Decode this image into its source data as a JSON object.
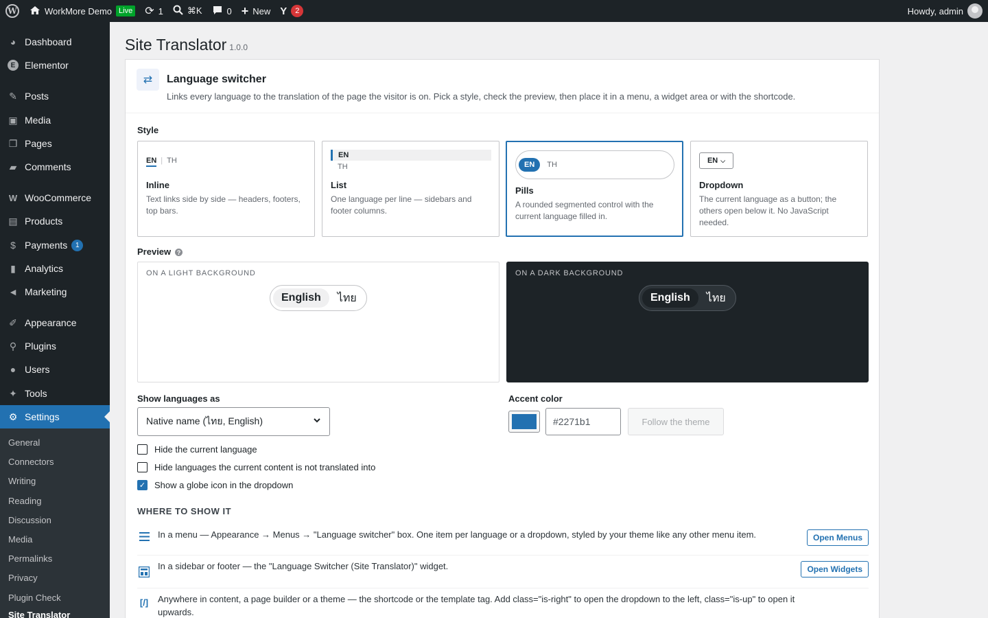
{
  "adminbar": {
    "site_name": "WorkMore Demo",
    "live_badge": "Live",
    "updates_count": "1",
    "search_shortcut": "⌘K",
    "comments_count": "0",
    "new_label": "New",
    "yoast_count": "2",
    "howdy": "Howdy, admin"
  },
  "sidebar": {
    "items": [
      {
        "label": "Dashboard",
        "icon": "dashboard-icon"
      },
      {
        "label": "Elementor",
        "icon": "elementor-icon"
      },
      {
        "label": "Posts",
        "icon": "pin-icon"
      },
      {
        "label": "Media",
        "icon": "media-icon"
      },
      {
        "label": "Pages",
        "icon": "pages-icon"
      },
      {
        "label": "Comments",
        "icon": "comment-icon"
      },
      {
        "label": "WooCommerce",
        "icon": "woo-icon"
      },
      {
        "label": "Products",
        "icon": "archive-icon"
      },
      {
        "label": "Payments",
        "icon": "payments-icon",
        "badge": "1"
      },
      {
        "label": "Analytics",
        "icon": "bar-chart-icon"
      },
      {
        "label": "Marketing",
        "icon": "megaphone-icon"
      },
      {
        "label": "Appearance",
        "icon": "brush-icon"
      },
      {
        "label": "Plugins",
        "icon": "plugin-icon"
      },
      {
        "label": "Users",
        "icon": "user-icon"
      },
      {
        "label": "Tools",
        "icon": "wrench-icon"
      },
      {
        "label": "Settings",
        "icon": "settings-icon"
      }
    ],
    "submenu": [
      "General",
      "Connectors",
      "Writing",
      "Reading",
      "Discussion",
      "Media",
      "Permalinks",
      "Privacy",
      "Plugin Check",
      "Site Translator"
    ]
  },
  "page": {
    "title": "Site Translator",
    "version": "1.0.0"
  },
  "card": {
    "title": "Language switcher",
    "description": "Links every language to the translation of the page the visitor is on. Pick a style, check the preview, then place it in a menu, a widget area or with the shortcode."
  },
  "style": {
    "label": "Style",
    "options": [
      {
        "name": "Inline",
        "desc": "Text links side by side — headers, footers, top bars.",
        "sample_on": "EN",
        "sample_off": "TH"
      },
      {
        "name": "List",
        "desc": "One language per line — sidebars and footer columns.",
        "sample_on": "EN",
        "sample_off": "TH"
      },
      {
        "name": "Pills",
        "desc": "A rounded segmented control with the current language filled in.",
        "sample_on": "EN",
        "sample_off": "TH"
      },
      {
        "name": "Dropdown",
        "desc": "The current language as a button; the others open below it. No JavaScript needed.",
        "sample_on": "EN"
      }
    ],
    "selected": "Pills"
  },
  "preview": {
    "label": "Preview",
    "help": "?",
    "light_caption": "ON A LIGHT BACKGROUND",
    "dark_caption": "ON A DARK BACKGROUND",
    "lang_current": "English",
    "lang_other": "ไทย"
  },
  "show_as": {
    "label": "Show languages as",
    "value": "Native name (ไทย, English)"
  },
  "accent": {
    "label": "Accent color",
    "color": "#2271b1",
    "hex_value": "#2271b1",
    "theme_button": "Follow the theme"
  },
  "options": [
    {
      "label": "Hide the current language",
      "checked": false
    },
    {
      "label": "Hide languages the current content is not translated into",
      "checked": false
    },
    {
      "label": "Show a globe icon in the dropdown",
      "checked": true
    }
  ],
  "where": {
    "heading": "WHERE TO SHOW IT",
    "rows": [
      {
        "icon": "menu-icon",
        "text": "In a menu — Appearance → Menus → \"Language switcher\" box. One item per language or a dropdown, styled by your theme like any other menu item.",
        "button": "Open Menus"
      },
      {
        "icon": "widget-icon",
        "text": "In a sidebar or footer — the \"Language Switcher (Site Translator)\" widget.",
        "button": "Open Widgets"
      },
      {
        "icon": "shortcode-icon",
        "text_line1": "Anywhere in content, a page builder or a theme — the shortcode or the template tag. Add class=\"is-right\" to open the dropdown to the left, class=\"is-up\" to open it",
        "text_line2": "upwards."
      }
    ]
  }
}
